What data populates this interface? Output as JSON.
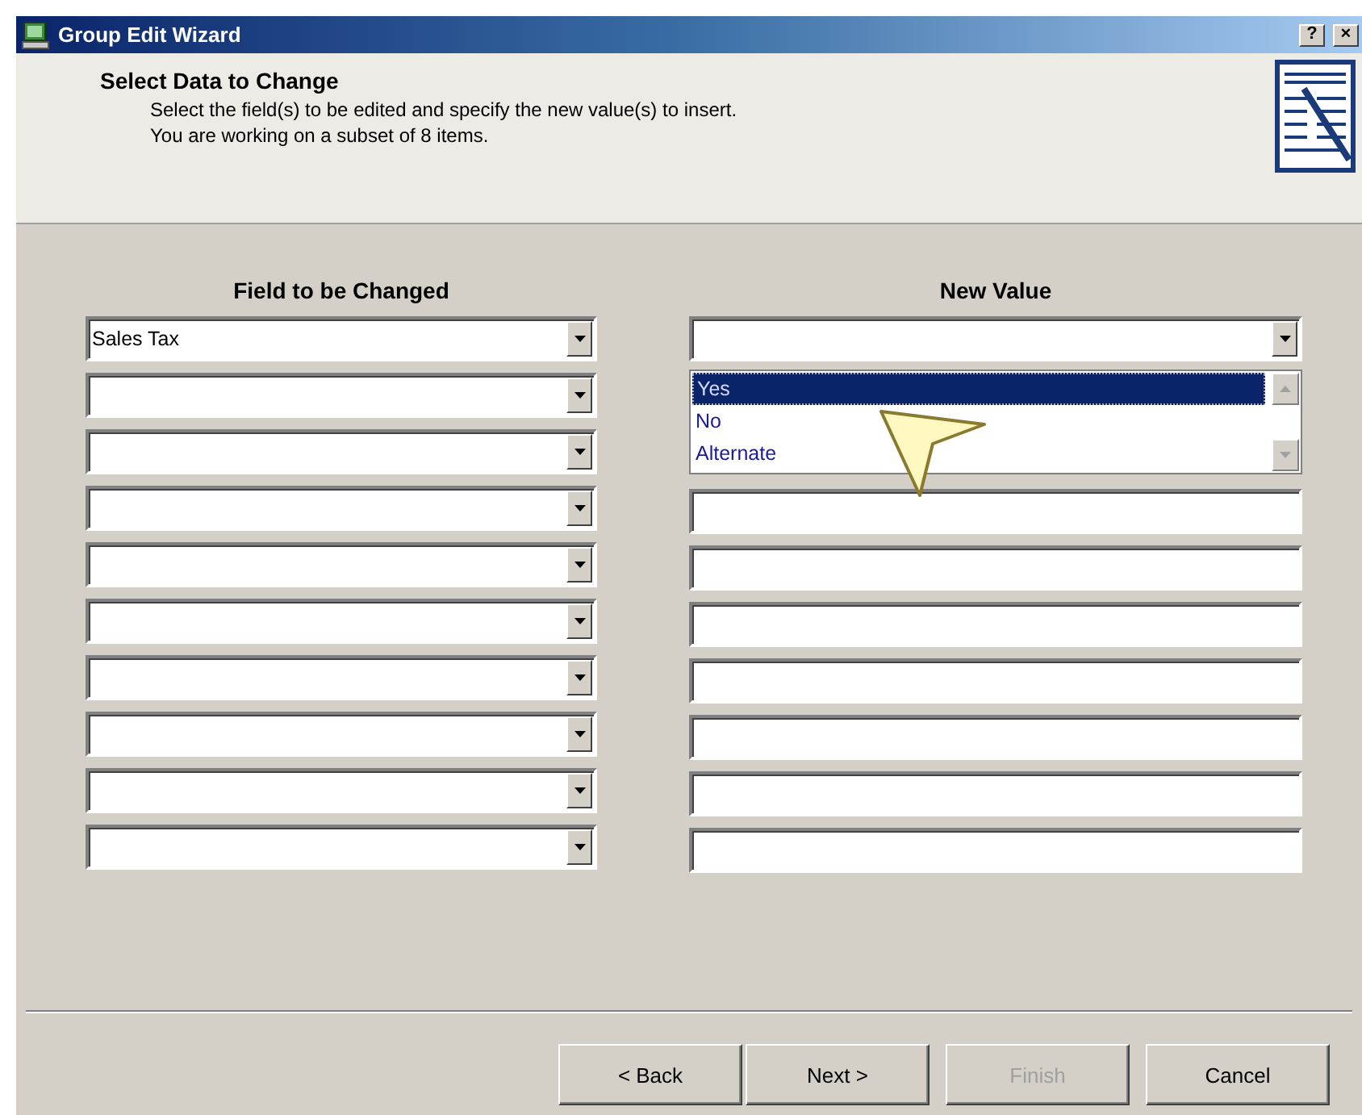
{
  "window": {
    "title": "Group Edit Wizard",
    "title_buttons": [
      "?",
      "×"
    ]
  },
  "header": {
    "title": "Select Data to Change",
    "lines": [
      "Select the field(s) to be edited and specify the new value(s) to insert.",
      "You are working on a subset of 8 items."
    ]
  },
  "columns": {
    "field": "Field to be Changed",
    "value": "New Value"
  },
  "field_rows": [
    {
      "kind": "dropdown",
      "value": "Sales Tax"
    },
    {
      "kind": "dropdown"
    },
    {
      "kind": "dropdown"
    },
    {
      "kind": "dropdown"
    },
    {
      "kind": "dropdown"
    },
    {
      "kind": "dropdown"
    },
    {
      "kind": "dropdown"
    },
    {
      "kind": "dropdown"
    },
    {
      "kind": "dropdown"
    },
    {
      "kind": "dropdown"
    }
  ],
  "value_rows": [
    {
      "kind": "dropdown",
      "expanded": true,
      "options": [
        {
          "label": "Yes",
          "selected": true
        },
        {
          "label": "No",
          "selected": false
        },
        {
          "label": "Alternate",
          "selected": false
        }
      ]
    },
    {
      "kind": "text"
    },
    {
      "kind": "text"
    },
    {
      "kind": "text"
    },
    {
      "kind": "text"
    },
    {
      "kind": "text"
    },
    {
      "kind": "text"
    },
    {
      "kind": "text"
    }
  ],
  "buttons": [
    {
      "label": "< Back",
      "disabled": false
    },
    {
      "label": "Next >",
      "disabled": false
    },
    {
      "label": "Finish",
      "disabled": true
    },
    {
      "label": "Cancel",
      "disabled": false
    }
  ]
}
